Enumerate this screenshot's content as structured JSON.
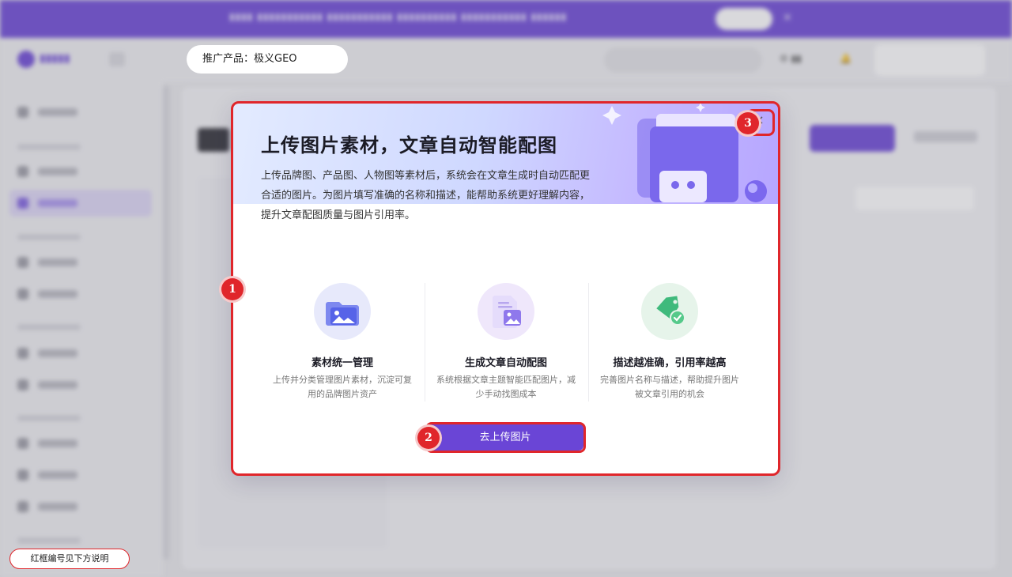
{
  "background": {
    "product_pill": "推广产品：极义GEO"
  },
  "modal": {
    "title": "上传图片素材，文章自动智能配图",
    "description": "上传品牌图、产品图、人物图等素材后，系统会在文章生成时自动匹配更合适的图片。为图片填写准确的名称和描述，能帮助系统更好理解内容，提升文章配图质量与图片引用率。",
    "features": [
      {
        "title": "素材统一管理",
        "desc": "上传并分类管理图片素材，沉淀可复用的品牌图片资产",
        "icon": "folder-image-icon"
      },
      {
        "title": "生成文章自动配图",
        "desc": "系统根据文章主题智能匹配图片，减少手动找图成本",
        "icon": "document-image-icon"
      },
      {
        "title": "描述越准确，引用率越高",
        "desc": "完善图片名称与描述，帮助提升图片被文章引用的机会",
        "icon": "tag-check-icon"
      }
    ],
    "cta_label": "去上传图片",
    "close_glyph": "×"
  },
  "annotations": {
    "badges": [
      "1",
      "2",
      "3"
    ],
    "note": "红框编号见下方说明"
  },
  "colors": {
    "primary": "#6a45d6",
    "annotation_red": "#e0262b"
  }
}
